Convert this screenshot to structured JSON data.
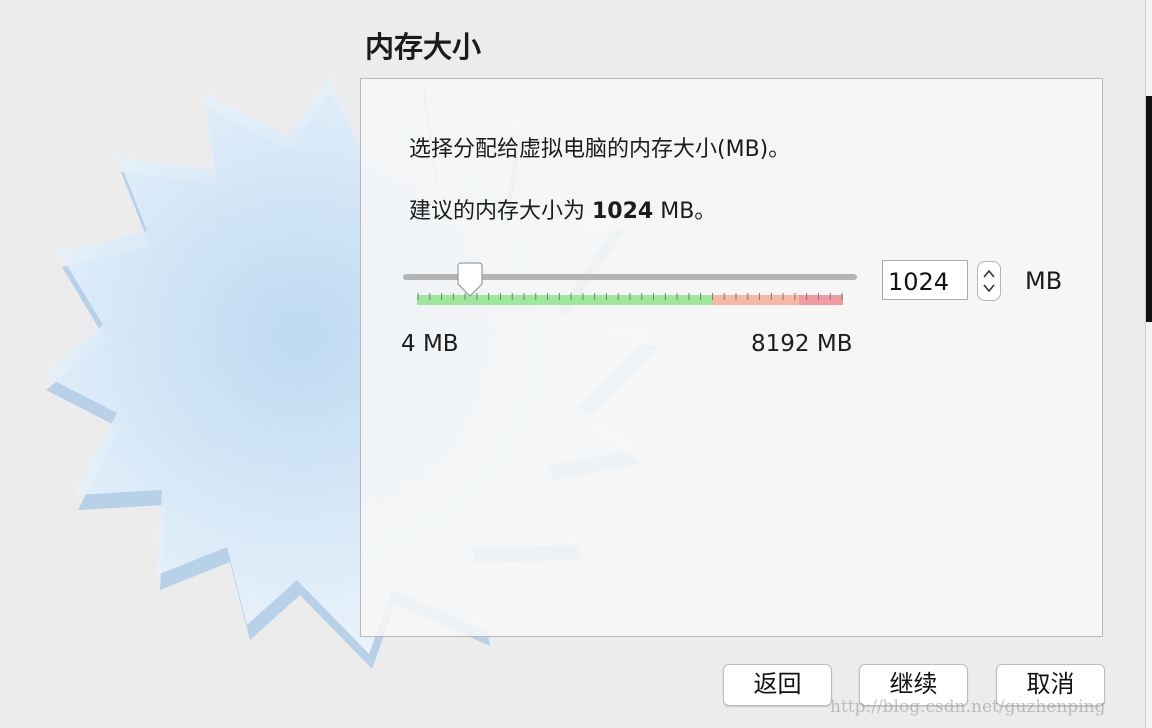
{
  "page": {
    "title": "内存大小"
  },
  "panel": {
    "description": "选择分配给虚拟电脑的内存大小(MB)。",
    "recommend_prefix": "建议的内存大小为 ",
    "recommend_value": "1024",
    "recommend_suffix": " MB。"
  },
  "memory": {
    "value": "1024",
    "unit": "MB",
    "min_label": "4 MB",
    "max_label": "8192 MB",
    "slider_fraction": 0.125
  },
  "buttons": {
    "back": "返回",
    "continue": "继续",
    "cancel": "取消"
  },
  "watermark": "http://blog.csdn.net/guzhenping",
  "colors": {
    "safe": "#9de89a",
    "warning": "#f6b8a4",
    "danger": "#f19a9f"
  }
}
